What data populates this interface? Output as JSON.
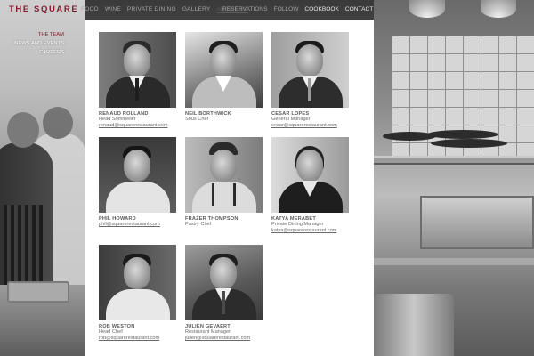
{
  "logo": "THE SQUARE",
  "nav": {
    "items": [
      "FOOD",
      "WINE",
      "PRIVATE DINING",
      "GALLERY",
      "ABOUT US",
      "RESERVATIONS",
      "FOLLOW",
      "COOKBOOK",
      "CONTACT"
    ],
    "active": "ABOUT US"
  },
  "subnav": {
    "items": [
      "THE TEAM",
      "NEWS AND EVENTS",
      "CAREERS"
    ],
    "active": "THE TEAM"
  },
  "team": [
    {
      "name": "RENAUD ROLLAND",
      "role": "Head Sommelier",
      "email": "renaud@squarerestaurant.com"
    },
    {
      "name": "NEIL BORTHWICK",
      "role": "Sous Chef",
      "email": ""
    },
    {
      "name": "CESAR LOPES",
      "role": "General Manager",
      "email": "cesar@squarerestaurant.com"
    },
    {
      "name": "PHIL HOWARD",
      "role": "",
      "email": "phil@squarerestaurant.com"
    },
    {
      "name": "FRAZER THOMPSON",
      "role": "Pastry Chef",
      "email": ""
    },
    {
      "name": "KATYA MERABET",
      "role": "Private Dining Manager",
      "email": "katya@squarerestaurant.com"
    },
    {
      "name": "ROB WESTON",
      "role": "Head Chef",
      "email": "rob@squarerestaurant.com"
    },
    {
      "name": "JULIEN GEVAERT",
      "role": "Restaurant Manager",
      "email": "julien@squarerestaurant.com"
    }
  ],
  "colors": {
    "brand": "#8a1a2e"
  }
}
